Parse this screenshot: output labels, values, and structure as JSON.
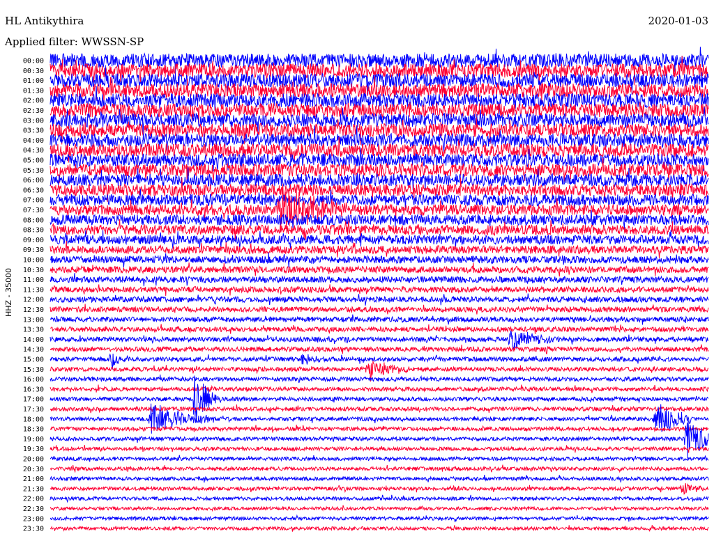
{
  "station": "HL Antikythira",
  "date": "2020-01-03",
  "filter": "Applied filter: WWSSN-SP",
  "chart_data": {
    "type": "helicorder",
    "channel_label": "HHZ - 35000",
    "row_minutes": 30,
    "colors": {
      "blue": "#0000ff",
      "red": "#ff0033"
    },
    "row_labels": [
      "00:00",
      "00:30",
      "01:00",
      "01:30",
      "02:00",
      "02:30",
      "03:00",
      "03:30",
      "04:00",
      "04:30",
      "05:00",
      "05:30",
      "06:00",
      "06:30",
      "07:00",
      "07:30",
      "08:00",
      "08:30",
      "09:00",
      "09:30",
      "10:00",
      "10:30",
      "11:00",
      "11:30",
      "12:00",
      "12:30",
      "13:00",
      "13:30",
      "14:00",
      "14:30",
      "15:00",
      "15:30",
      "16:00",
      "16:30",
      "17:00",
      "17:30",
      "18:00",
      "18:30",
      "19:00",
      "19:30",
      "20:00",
      "20:30",
      "21:00",
      "21:30",
      "22:00",
      "22:30",
      "23:00",
      "23:30"
    ],
    "noise_level": [
      1.0,
      1.0,
      1.0,
      1.0,
      1.0,
      0.98,
      0.97,
      0.96,
      0.95,
      0.94,
      0.92,
      0.9,
      0.88,
      0.85,
      0.82,
      0.78,
      0.75,
      0.7,
      0.65,
      0.58,
      0.52,
      0.48,
      0.44,
      0.42,
      0.4,
      0.38,
      0.36,
      0.35,
      0.34,
      0.33,
      0.32,
      0.31,
      0.3,
      0.3,
      0.29,
      0.29,
      0.28,
      0.28,
      0.27,
      0.27,
      0.26,
      0.26,
      0.26,
      0.25,
      0.25,
      0.24,
      0.24,
      0.24
    ],
    "events": [
      {
        "row": 15,
        "minute": 10.5,
        "amp": 2.5,
        "duration_min": 1.5
      },
      {
        "row": 28,
        "minute": 21.0,
        "amp": 1.2,
        "duration_min": 1.0
      },
      {
        "row": 30,
        "minute": 2.8,
        "amp": 1.0,
        "duration_min": 0.3
      },
      {
        "row": 30,
        "minute": 11.5,
        "amp": 0.7,
        "duration_min": 0.5
      },
      {
        "row": 31,
        "minute": 14.5,
        "amp": 1.0,
        "duration_min": 1.0
      },
      {
        "row": 34,
        "minute": 6.6,
        "amp": 2.4,
        "duration_min": 0.6
      },
      {
        "row": 36,
        "minute": 4.6,
        "amp": 1.5,
        "duration_min": 1.4
      },
      {
        "row": 36,
        "minute": 27.6,
        "amp": 2.0,
        "duration_min": 0.8
      },
      {
        "row": 38,
        "minute": 29.0,
        "amp": 2.2,
        "duration_min": 0.8
      },
      {
        "row": 43,
        "minute": 28.8,
        "amp": 0.6,
        "duration_min": 0.8
      }
    ]
  }
}
